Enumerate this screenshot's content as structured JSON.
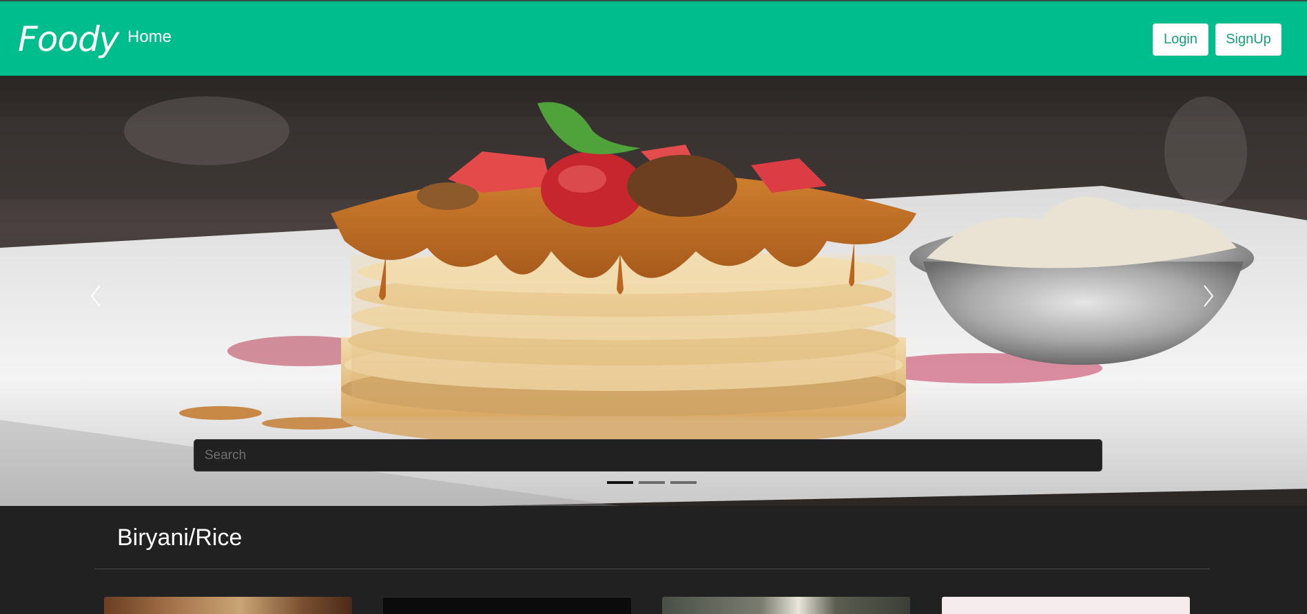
{
  "navbar": {
    "brand": "Foody",
    "home_label": "Home",
    "login_label": "Login",
    "signup_label": "SignUp",
    "color": "#00bd8d"
  },
  "carousel": {
    "search_placeholder": "Search",
    "slide_count": 3,
    "active_slide": 1,
    "prev_icon": "chevron-left-icon",
    "next_icon": "chevron-right-icon"
  },
  "section": {
    "title": "Biryani/Rice"
  }
}
